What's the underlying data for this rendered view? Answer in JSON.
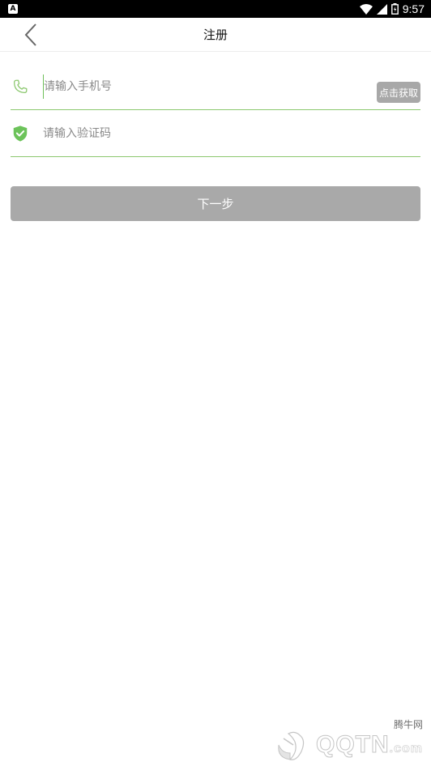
{
  "status_bar": {
    "notification_icon": "A",
    "time": "9:57",
    "icons": [
      "wifi-icon",
      "signal-icon",
      "battery-icon"
    ]
  },
  "header": {
    "title": "注册",
    "back_icon": "chevron-left-icon"
  },
  "form": {
    "phone": {
      "placeholder": "请输入手机号",
      "icon": "phone-icon",
      "get_code_label": "点击获取"
    },
    "code": {
      "placeholder": "请输入验证码",
      "icon": "shield-check-icon"
    }
  },
  "next_button_label": "下一步",
  "watermark": {
    "cn": "腾牛网",
    "en": "QQTN",
    "suffix": ".com"
  },
  "colors": {
    "accent_green": "#8cc86f",
    "button_gray": "#a9a9a9"
  }
}
